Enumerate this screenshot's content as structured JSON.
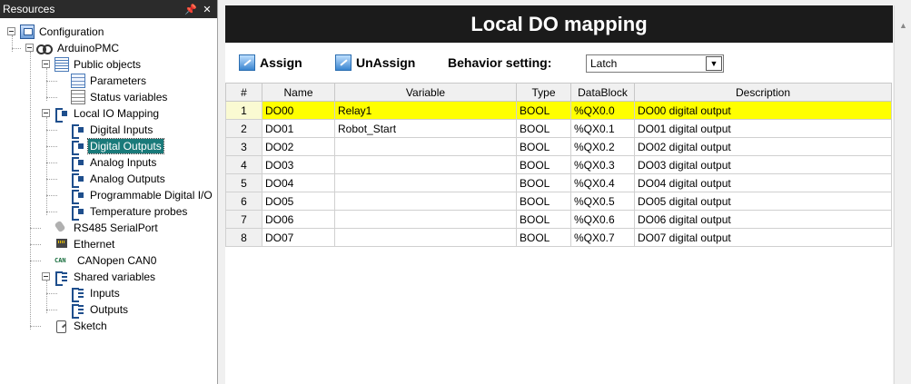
{
  "resources_panel": {
    "title": "Resources",
    "pin_glyph": "📌",
    "close_glyph": "✕",
    "tree": [
      {
        "label": "Configuration",
        "icon": "config-icon"
      },
      {
        "label": "ArduinoPMC",
        "icon": "arduino-icon"
      },
      {
        "label": "Public objects",
        "icon": "list-icon"
      },
      {
        "label": "Parameters",
        "icon": "list-icon"
      },
      {
        "label": "Status variables",
        "icon": "status-icon"
      },
      {
        "label": "Local IO Mapping",
        "icon": "io-icon"
      },
      {
        "label": "Digital Inputs",
        "icon": "io-icon"
      },
      {
        "label": "Digital Outputs",
        "icon": "io-icon",
        "selected": true
      },
      {
        "label": "Analog Inputs",
        "icon": "io-icon"
      },
      {
        "label": "Analog Outputs",
        "icon": "io-icon"
      },
      {
        "label": "Programmable Digital I/O",
        "icon": "io-icon"
      },
      {
        "label": "Temperature probes",
        "icon": "io-icon"
      },
      {
        "label": "RS485 SerialPort",
        "icon": "serial-icon"
      },
      {
        "label": "Ethernet",
        "icon": "ethernet-icon"
      },
      {
        "label": "CANopen CAN0",
        "icon": "can-icon",
        "icon_text": "CAN"
      },
      {
        "label": "Shared variables",
        "icon": "shared-icon"
      },
      {
        "label": "Inputs",
        "icon": "shared-icon"
      },
      {
        "label": "Outputs",
        "icon": "shared-icon"
      },
      {
        "label": "Sketch",
        "icon": "sketch-icon"
      }
    ]
  },
  "main": {
    "title": "Local DO mapping",
    "toolbar": {
      "assign_label": "Assign",
      "unassign_label": "UnAssign",
      "behavior_label": "Behavior setting:",
      "behavior_value": "Latch",
      "dropdown_arrow": "▼"
    },
    "table": {
      "columns": [
        "#",
        "Name",
        "Variable",
        "Type",
        "DataBlock",
        "Description"
      ],
      "rows": [
        {
          "num": "1",
          "name": "DO00",
          "variable": "Relay1",
          "type": "BOOL",
          "datablock": "%QX0.0",
          "description": "DO00 digital output",
          "selected": true
        },
        {
          "num": "2",
          "name": "DO01",
          "variable": "Robot_Start",
          "type": "BOOL",
          "datablock": "%QX0.1",
          "description": "DO01 digital output"
        },
        {
          "num": "3",
          "name": "DO02",
          "variable": "",
          "type": "BOOL",
          "datablock": "%QX0.2",
          "description": "DO02 digital output"
        },
        {
          "num": "4",
          "name": "DO03",
          "variable": "",
          "type": "BOOL",
          "datablock": "%QX0.3",
          "description": "DO03 digital output"
        },
        {
          "num": "5",
          "name": "DO04",
          "variable": "",
          "type": "BOOL",
          "datablock": "%QX0.4",
          "description": "DO04 digital output"
        },
        {
          "num": "6",
          "name": "DO05",
          "variable": "",
          "type": "BOOL",
          "datablock": "%QX0.5",
          "description": "DO05 digital output"
        },
        {
          "num": "7",
          "name": "DO06",
          "variable": "",
          "type": "BOOL",
          "datablock": "%QX0.6",
          "description": "DO06 digital output"
        },
        {
          "num": "8",
          "name": "DO07",
          "variable": "",
          "type": "BOOL",
          "datablock": "%QX0.7",
          "description": "DO07 digital output"
        }
      ]
    }
  },
  "scrollbar": {
    "up_arrow": "▲"
  },
  "colors": {
    "selected_row": "#ffff00",
    "selected_tree": "#1a7a7a",
    "title_bar": "#1b1b1b"
  }
}
